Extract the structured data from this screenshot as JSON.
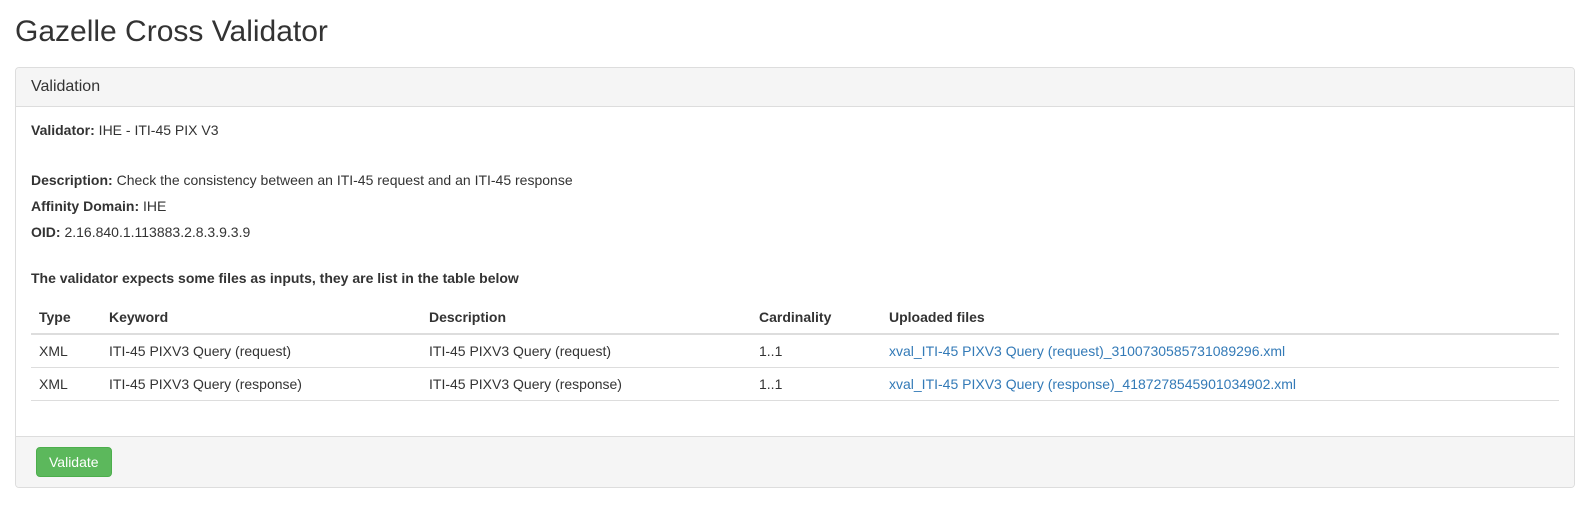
{
  "page_title": "Gazelle Cross Validator",
  "panel": {
    "heading": "Validation",
    "fields": {
      "validator_label": "Validator:",
      "validator_value": " IHE - ITI-45 PIX V3",
      "description_label": "Description:",
      "description_value": " Check the consistency between an ITI-45 request and an ITI-45 response",
      "affinity_label": "Affinity Domain:",
      "affinity_value": " IHE",
      "oid_label": "OID:",
      "oid_value": " 2.16.840.1.113883.2.8.3.9.3.9"
    },
    "section_note": "The validator expects some files as inputs, they are list in the table below",
    "table": {
      "headers": {
        "type": "Type",
        "keyword": "Keyword",
        "description": "Description",
        "cardinality": "Cardinality",
        "uploaded": "Uploaded files"
      },
      "rows": [
        {
          "type": "XML",
          "keyword": "ITI-45 PIXV3 Query (request)",
          "description": "ITI-45 PIXV3 Query (request)",
          "cardinality": "1..1",
          "uploaded": "xval_ITI-45 PIXV3 Query (request)_3100730585731089296.xml"
        },
        {
          "type": "XML",
          "keyword": "ITI-45 PIXV3 Query (response)",
          "description": "ITI-45 PIXV3 Query (response)",
          "cardinality": "1..1",
          "uploaded": "xval_ITI-45 PIXV3 Query (response)_4187278545901034902.xml"
        }
      ]
    },
    "validate_button": "Validate"
  }
}
